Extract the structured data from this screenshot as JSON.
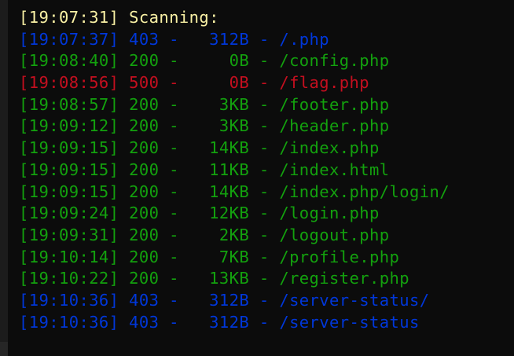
{
  "terminal": {
    "header": {
      "timestamp": "[19:07:31]",
      "label": "Scanning:"
    },
    "colors": {
      "background": "#0c0c0c",
      "header": "#f9f1a5",
      "status_200": "#13a10e",
      "status_403": "#0037da",
      "status_500": "#c50f1f"
    },
    "lines": [
      {
        "timestamp": "[19:07:37]",
        "status": "403",
        "size": "312B",
        "path": "/.php",
        "color": "blue"
      },
      {
        "timestamp": "[19:08:40]",
        "status": "200",
        "size": "0B",
        "path": "/config.php",
        "color": "green"
      },
      {
        "timestamp": "[19:08:56]",
        "status": "500",
        "size": "0B",
        "path": "/flag.php",
        "color": "red"
      },
      {
        "timestamp": "[19:08:57]",
        "status": "200",
        "size": "3KB",
        "path": "/footer.php",
        "color": "green"
      },
      {
        "timestamp": "[19:09:12]",
        "status": "200",
        "size": "3KB",
        "path": "/header.php",
        "color": "green"
      },
      {
        "timestamp": "[19:09:15]",
        "status": "200",
        "size": "14KB",
        "path": "/index.php",
        "color": "green"
      },
      {
        "timestamp": "[19:09:15]",
        "status": "200",
        "size": "11KB",
        "path": "/index.html",
        "color": "green"
      },
      {
        "timestamp": "[19:09:15]",
        "status": "200",
        "size": "14KB",
        "path": "/index.php/login/",
        "color": "green"
      },
      {
        "timestamp": "[19:09:24]",
        "status": "200",
        "size": "12KB",
        "path": "/login.php",
        "color": "green"
      },
      {
        "timestamp": "[19:09:31]",
        "status": "200",
        "size": "2KB",
        "path": "/logout.php",
        "color": "green"
      },
      {
        "timestamp": "[19:10:14]",
        "status": "200",
        "size": "7KB",
        "path": "/profile.php",
        "color": "green"
      },
      {
        "timestamp": "[19:10:22]",
        "status": "200",
        "size": "13KB",
        "path": "/register.php",
        "color": "green"
      },
      {
        "timestamp": "[19:10:36]",
        "status": "403",
        "size": "312B",
        "path": "/server-status/",
        "color": "blue"
      },
      {
        "timestamp": "[19:10:36]",
        "status": "403",
        "size": "312B",
        "path": "/server-status",
        "color": "blue"
      }
    ]
  }
}
